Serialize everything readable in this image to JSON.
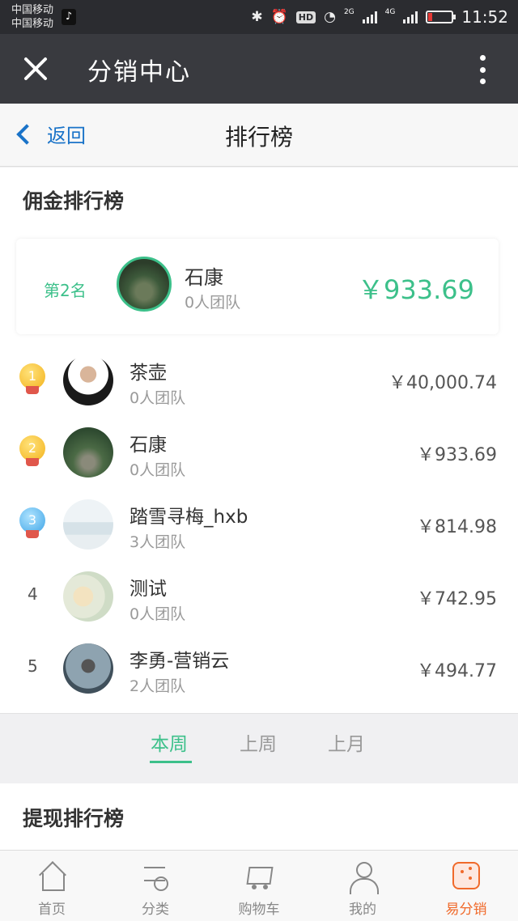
{
  "status_bar": {
    "carrier_1": "中国移动",
    "carrier_2": "中国移动",
    "network_2g": "2G",
    "network_4g": "4G",
    "hd": "HD",
    "time": "11:52"
  },
  "nav": {
    "title": "分销中心"
  },
  "page_header": {
    "back_label": "返回",
    "title": "排行榜"
  },
  "commission_ranking": {
    "title": "佣金排行榜",
    "my_entry": {
      "rank": "第2名",
      "name": "石康",
      "team": "0人团队",
      "amount": "￥933.69"
    },
    "rows": [
      {
        "rank": "1",
        "name": "茶壶",
        "team": "0人团队",
        "amount": "￥40,000.74"
      },
      {
        "rank": "2",
        "name": "石康",
        "team": "0人团队",
        "amount": "￥933.69"
      },
      {
        "rank": "3",
        "name": "踏雪寻梅_hxb",
        "team": "3人团队",
        "amount": "￥814.98"
      },
      {
        "rank": "4",
        "name": "测试",
        "team": "0人团队",
        "amount": "￥742.95"
      },
      {
        "rank": "5",
        "name": "李勇-营销云",
        "team": "2人团队",
        "amount": "￥494.77"
      }
    ]
  },
  "period_tabs": [
    {
      "label": "本周",
      "active": true
    },
    {
      "label": "上周",
      "active": false
    },
    {
      "label": "上月",
      "active": false
    }
  ],
  "withdraw_ranking": {
    "title": "提现排行榜"
  },
  "bottom_nav": [
    {
      "label": "首页",
      "icon": "home-icon"
    },
    {
      "label": "分类",
      "icon": "category-icon"
    },
    {
      "label": "购物车",
      "icon": "cart-icon"
    },
    {
      "label": "我的",
      "icon": "user-icon"
    },
    {
      "label": "易分销",
      "icon": "share-icon",
      "active": true
    }
  ],
  "colors": {
    "accent_green": "#3cc08a",
    "link_blue": "#1a73c8",
    "active_orange": "#f06a2b",
    "navbar": "#393a3f"
  }
}
